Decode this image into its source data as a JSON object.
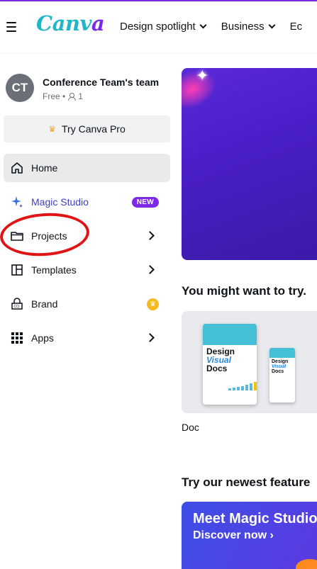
{
  "header": {
    "logo_text": "Canva",
    "nav": [
      {
        "label": "Design spotlight"
      },
      {
        "label": "Business"
      },
      {
        "label": "Ec"
      }
    ]
  },
  "team": {
    "initials": "CT",
    "name": "Conference Team's team",
    "plan": "Free •",
    "members": "1"
  },
  "sidebar": {
    "try_pro": "Try Canva Pro",
    "items": [
      {
        "label": "Home",
        "icon": "home-icon",
        "active": true
      },
      {
        "label": "Magic Studio",
        "icon": "sparkle-icon",
        "badge": "NEW"
      },
      {
        "label": "Projects",
        "icon": "folder-icon"
      },
      {
        "label": "Templates",
        "icon": "templates-icon"
      },
      {
        "label": "Brand",
        "icon": "brand-icon"
      },
      {
        "label": "Apps",
        "icon": "apps-icon"
      }
    ]
  },
  "main": {
    "suggest_title": "You might want to try.",
    "card": {
      "label": "Doc",
      "thumb_line1": "Design",
      "thumb_line2": "Visual",
      "thumb_line3": "Docs"
    },
    "features_title": "Try our newest feature",
    "banner": {
      "title": "Meet Magic Studio",
      "link": "Discover now ›"
    }
  },
  "colors": {
    "accent": "#7d2ae8",
    "annotation": "#e01414"
  }
}
